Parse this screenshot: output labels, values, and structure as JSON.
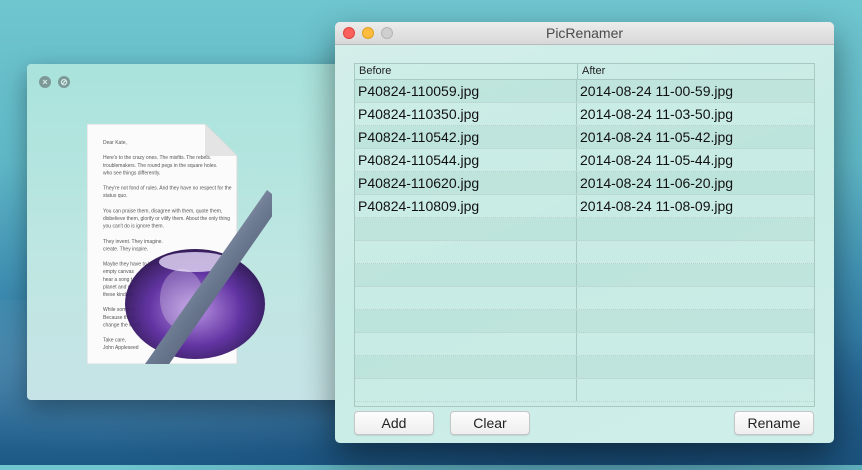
{
  "app": {
    "title": "PicRenamer"
  },
  "table": {
    "columns": [
      "Before",
      "After"
    ],
    "rows": [
      [
        "P40824-110059.jpg",
        "2014-08-24 11-00-59.jpg"
      ],
      [
        "P40824-110350.jpg",
        "2014-08-24 11-03-50.jpg"
      ],
      [
        "P40824-110542.jpg",
        "2014-08-24 11-05-42.jpg"
      ],
      [
        "P40824-110544.jpg",
        "2014-08-24 11-05-44.jpg"
      ],
      [
        "P40824-110620.jpg",
        "2014-08-24 11-06-20.jpg"
      ],
      [
        "P40824-110809.jpg",
        "2014-08-24 11-08-09.jpg"
      ]
    ]
  },
  "buttons": {
    "add": "Add",
    "clear": "Clear",
    "rename": "Rename"
  },
  "back_window": {
    "icons": [
      "close-icon",
      "fullscreen-icon"
    ],
    "document_icon": "textedit-icon",
    "letter_lines": [
      "Dear Kate,",
      "",
      "Here's to the crazy ones. The misfits. The rebels.",
      "troublemakers. The round pegs in the square holes.",
      "who see things differently.",
      "",
      "They're not fond of rules. And they have no respect for the",
      "status quo.",
      "",
      "You can praise them, disagree with them, quote them,",
      "disbelieve them, glorify or vilify them. About the only thing",
      "you can't do is ignore them.",
      "",
      "They invent. They imagine.",
      "create. They inspire.",
      "",
      "Maybe they have to be crazy.",
      "empty canvas",
      "hear a song t",
      "planet and se",
      "these kinds o",
      "",
      "While some se",
      "Because the p",
      "change the world",
      "",
      "Take care,",
      "John Appleseed"
    ]
  },
  "colors": {
    "close": "#fc605c",
    "minimize": "#fdbc40",
    "zoom": "#cfcfcf"
  }
}
